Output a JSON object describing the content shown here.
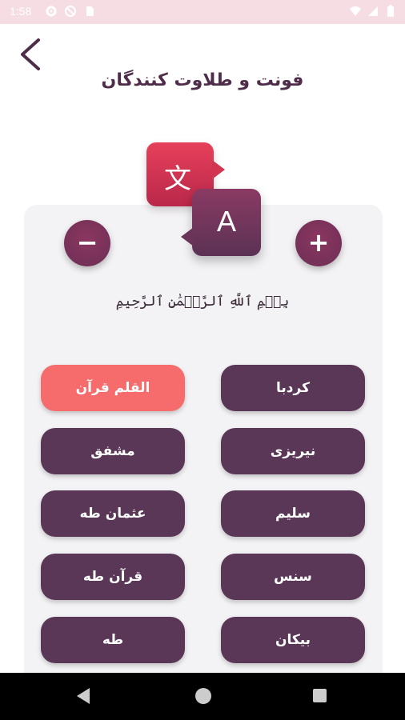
{
  "status_bar": {
    "time": "1:58",
    "left_icons": [
      "gear-icon",
      "block-icon",
      "sim-icon"
    ],
    "right_icons": [
      "wifi-icon",
      "signal-icon",
      "battery-icon"
    ]
  },
  "header": {
    "title": "فونت و طلاوت کنندگان",
    "back_icon": "chevron-left-icon"
  },
  "illustration": {
    "back_bubble_glyph": "文",
    "front_bubble_glyph": "A"
  },
  "controls": {
    "decrease_label": "−",
    "increase_label": "+"
  },
  "preview": {
    "text": "بِسۡمِ ٱللَّهِ ٱلرَّحۡمَٰنِ ٱلرَّحِيمِ"
  },
  "fonts": {
    "right_column": [
      "کردبا",
      "نیریزی",
      "سلیم",
      "سنس",
      "بیکان"
    ],
    "left_column": [
      "القلم قرآن",
      "مشفق",
      "عثمان طه",
      "قرآن طه",
      "طه"
    ],
    "selected": "القلم قرآن"
  },
  "colors": {
    "primary": "#5a3657",
    "accent": "#f66b6b",
    "status_bar": "#f6dde4"
  },
  "nav_bar": {
    "icons": [
      "nav-back-icon",
      "nav-home-icon",
      "nav-recents-icon"
    ]
  }
}
